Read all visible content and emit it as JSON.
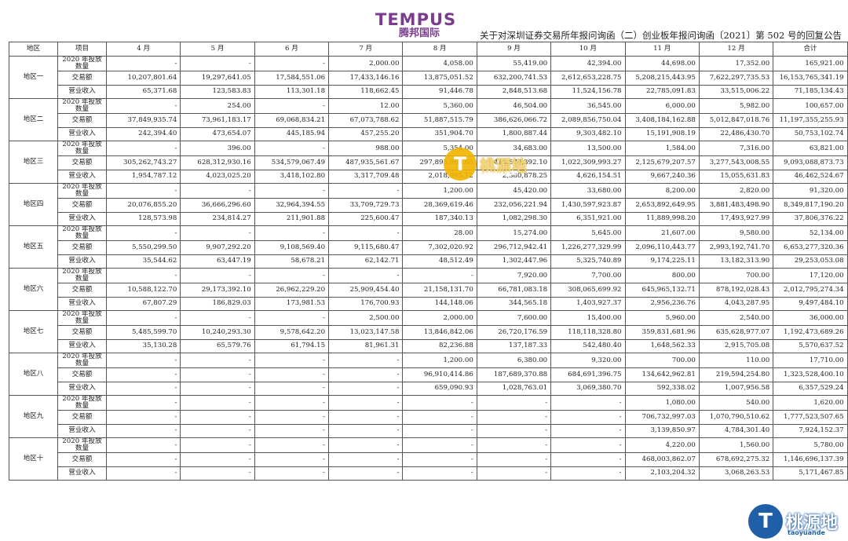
{
  "header": {
    "logo_main": "TEMPUS",
    "logo_sub": "腾邦国际",
    "title": "关于对深圳证券交易所年报问询函（二）创业板年报问询函〔2021〕第 502 号的回复公告"
  },
  "table": {
    "columns": [
      "地区",
      "项目",
      "4 月",
      "5 月",
      "6 月",
      "7 月",
      "8 月",
      "9 月",
      "10 月",
      "11 月",
      "12 月",
      "合计"
    ],
    "row_labels": [
      "2020 年投放数量",
      "交易额",
      "营业收入"
    ],
    "regions": [
      {
        "name": "地区一",
        "rows": [
          [
            "-",
            "-",
            "-",
            "2,000.00",
            "4,058.00",
            "55,419.00",
            "42,394.00",
            "44,698.00",
            "17,352.00",
            "165,921.00"
          ],
          [
            "10,207,801.64",
            "19,297,641.05",
            "17,584,551.06",
            "17,433,146.16",
            "13,875,051.52",
            "632,200,741.53",
            "2,612,653,228.75",
            "5,208,215,443.95",
            "7,622,297,735.53",
            "16,153,765,341.19"
          ],
          [
            "65,371.68",
            "123,583.83",
            "113,301.18",
            "118,662.45",
            "91,446.78",
            "2,848,513.68",
            "11,524,156.78",
            "22,785,091.83",
            "33,515,006.22",
            "71,185,134.43"
          ]
        ]
      },
      {
        "name": "地区二",
        "rows": [
          [
            "-",
            "254.00",
            "-",
            "12.00",
            "5,360.00",
            "46,504.00",
            "36,545.00",
            "6,000.00",
            "5,982.00",
            "100,657.00"
          ],
          [
            "37,849,935.74",
            "73,961,183.17",
            "69,068,834.21",
            "67,073,788.62",
            "51,887,515.79",
            "386,626,066.72",
            "2,089,856,750.04",
            "3,408,184,162.88",
            "5,012,847,018.76",
            "11,197,355,255.93"
          ],
          [
            "242,394.40",
            "473,654.07",
            "445,185.94",
            "457,255.20",
            "351,904.70",
            "1,800,887.44",
            "9,303,482.10",
            "15,191,908.19",
            "22,486,430.70",
            "50,753,102.74"
          ]
        ]
      },
      {
        "name": "地区三",
        "rows": [
          [
            "-",
            "396.00",
            "-",
            "988.00",
            "5,354.00",
            "34,683.00",
            "13,500.00",
            "1,584.00",
            "7,316.00",
            "63,821.00"
          ],
          [
            "305,262,743.27",
            "628,312,930.16",
            "534,579,067.49",
            "487,935,561.67",
            "297,895,969.65",
            "413,570,392.10",
            "1,022,309,993.27",
            "2,125,679,207.57",
            "3,277,543,008.55",
            "9,093,088,873.73"
          ],
          [
            "1,954,787.12",
            "4,023,025.20",
            "3,418,102.80",
            "3,317,709.48",
            "2,018,995.12",
            "2,380,878.25",
            "4,626,154.51",
            "9,667,240.36",
            "15,055,631.83",
            "46,462,524.67"
          ]
        ]
      },
      {
        "name": "地区四",
        "rows": [
          [
            "-",
            "-",
            "-",
            "-",
            "1,200.00",
            "45,420.00",
            "33,680.00",
            "8,200.00",
            "2,820.00",
            "91,320.00"
          ],
          [
            "20,076,855.20",
            "36,666,296.60",
            "32,964,394.55",
            "33,709,729.73",
            "28,369,619.46",
            "232,056,221.94",
            "1,430,597,923.87",
            "2,653,892,649.95",
            "3,881,483,498.90",
            "8,349,817,190.20"
          ],
          [
            "128,573.98",
            "234,814.27",
            "211,901.88",
            "225,600.47",
            "187,340.13",
            "1,082,298.30",
            "6,351,921.00",
            "11,889,998.20",
            "17,493,927.99",
            "37,806,376.22"
          ]
        ]
      },
      {
        "name": "地区五",
        "rows": [
          [
            "-",
            "-",
            "-",
            "-",
            "28.00",
            "15,274.00",
            "5,645.00",
            "21,607.00",
            "9,580.00",
            "52,134.00"
          ],
          [
            "5,550,299.50",
            "9,907,292.20",
            "9,108,569.40",
            "9,115,680.47",
            "7,302,020.92",
            "296,712,942.41",
            "1,226,277,329.99",
            "2,096,110,443.77",
            "2,993,192,741.70",
            "6,653,277,320.36"
          ],
          [
            "35,544.62",
            "63,447.19",
            "58,678.21",
            "62,142.71",
            "48,512.49",
            "1,302,447.96",
            "5,325,740.89",
            "9,174,225.11",
            "13,182,313.90",
            "29,253,053.08"
          ]
        ]
      },
      {
        "name": "地区六",
        "rows": [
          [
            "-",
            "-",
            "-",
            "-",
            "-",
            "7,920.00",
            "7,700.00",
            "800.00",
            "700.00",
            "17,120.00"
          ],
          [
            "10,588,122.70",
            "29,173,392.10",
            "26,962,229.20",
            "25,909,454.40",
            "21,158,131.70",
            "66,781,083.18",
            "308,065,699.92",
            "645,965,132.71",
            "878,192,028.43",
            "2,012,795,274.34"
          ],
          [
            "67,807.29",
            "186,829.03",
            "173,981.53",
            "176,700.93",
            "144,148.06",
            "344,565.18",
            "1,403,927.37",
            "2,956,236.76",
            "4,043,287.95",
            "9,497,484.10"
          ]
        ]
      },
      {
        "name": "地区七",
        "rows": [
          [
            "-",
            "-",
            "-",
            "2,500.00",
            "2,000.00",
            "7,600.00",
            "15,400.00",
            "5,960.00",
            "2,540.00",
            "36,000.00"
          ],
          [
            "5,485,599.70",
            "10,240,293.30",
            "9,578,642.20",
            "13,023,147.58",
            "13,846,842.06",
            "26,720,176.59",
            "118,118,328.80",
            "359,831,681.96",
            "635,628,977.07",
            "1,192,473,689.26"
          ],
          [
            "35,130.28",
            "65,579.76",
            "61,794.15",
            "81,961.31",
            "82,236.88",
            "137,187.33",
            "542,480.40",
            "1,648,562.33",
            "2,915,705.08",
            "5,570,637.52"
          ]
        ]
      },
      {
        "name": "地区八",
        "rows": [
          [
            "-",
            "-",
            "-",
            "-",
            "1,200.00",
            "6,380.00",
            "9,320.00",
            "700.00",
            "110.00",
            "17,710.00"
          ],
          [
            "-",
            "-",
            "-",
            "-",
            "96,910,414.86",
            "187,689,370.88",
            "684,691,396.75",
            "134,642,962.81",
            "219,594,254.80",
            "1,323,528,400.10"
          ],
          [
            "-",
            "-",
            "-",
            "-",
            "659,090.93",
            "1,028,763.01",
            "3,069,380.70",
            "592,338.02",
            "1,007,956.58",
            "6,357,529.24"
          ]
        ]
      },
      {
        "name": "地区九",
        "rows": [
          [
            "-",
            "-",
            "-",
            "-",
            "-",
            "-",
            "-",
            "1,080.00",
            "540.00",
            "1,620.00"
          ],
          [
            "-",
            "-",
            "-",
            "-",
            "-",
            "-",
            "-",
            "706,732,997.03",
            "1,070,790,510.62",
            "1,777,523,507.65"
          ],
          [
            "-",
            "-",
            "-",
            "-",
            "-",
            "-",
            "-",
            "3,139,850.97",
            "4,784,301.40",
            "7,924,152.37"
          ]
        ]
      },
      {
        "name": "地区十",
        "rows": [
          [
            "-",
            "-",
            "-",
            "-",
            "-",
            "-",
            "-",
            "4,220.00",
            "1,560.00",
            "5,780.00"
          ],
          [
            "-",
            "-",
            "-",
            "-",
            "-",
            "-",
            "-",
            "468,003,862.07",
            "678,692,275.32",
            "1,146,696,137.39"
          ],
          [
            "-",
            "-",
            "-",
            "-",
            "-",
            "-",
            "-",
            "2,103,204.32",
            "3,068,263.53",
            "5,171,467.85"
          ]
        ]
      }
    ]
  },
  "watermarks": [
    {
      "glyph": "T",
      "text": "桃源地",
      "sub": "taoyuande",
      "color": "#f2b400"
    },
    {
      "glyph": "T",
      "text": "桃源地",
      "sub": "taoyuande",
      "color": "#1f5fa8"
    }
  ]
}
